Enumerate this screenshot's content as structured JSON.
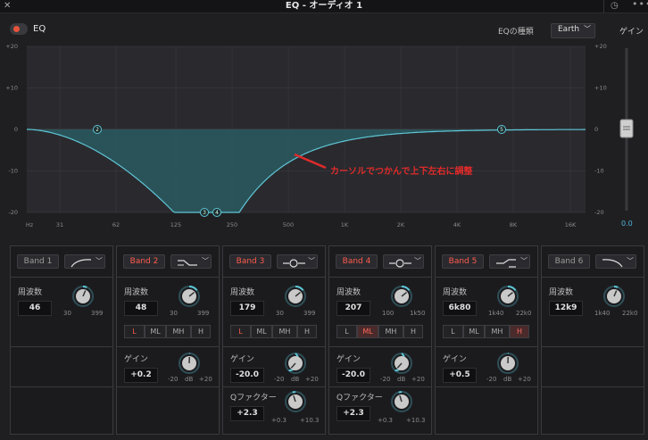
{
  "window": {
    "title": "EQ - オーディオ 1",
    "close": "✕",
    "history_icon": "◷",
    "more": "•••"
  },
  "header": {
    "eq_label": "EQ",
    "eq_type_label": "EQの種類",
    "eq_type_value": "Earth",
    "gain_label": "ゲイン"
  },
  "graph": {
    "y_ticks_left": [
      "+20",
      "+10",
      "0",
      "-10",
      "-20"
    ],
    "y_ticks_right": [
      "+20",
      "+10",
      "0",
      "-10",
      "-20"
    ],
    "x_ticks": [
      "Hz",
      "31",
      "62",
      "125",
      "250",
      "500",
      "1K",
      "2K",
      "4K",
      "8K",
      "16K"
    ],
    "annotation": "カーソルでつかんで上下左右に調整",
    "nodes": [
      "2",
      "3",
      "4",
      "5"
    ],
    "output_gain": "0.0",
    "colors": {
      "curve": "#5ec6d6",
      "fill": "#2a5a60",
      "annotation": "#e02a2a"
    }
  },
  "bands": [
    {
      "label": "Band 1",
      "active": false,
      "shape": "lowcut",
      "freq_label": "周波数",
      "freq": "46",
      "range": [
        "30",
        "399"
      ]
    },
    {
      "label": "Band 2",
      "active": true,
      "shape": "lowshelf",
      "freq_label": "周波数",
      "freq": "48",
      "range": [
        "30",
        "399"
      ],
      "segments": [
        "L",
        "ML",
        "MH",
        "H"
      ],
      "selected": "L",
      "gain_label": "ゲイン",
      "gain": "+0.2",
      "gain_range": [
        "-20",
        "dB",
        "+20"
      ]
    },
    {
      "label": "Band 3",
      "active": true,
      "shape": "bell",
      "freq_label": "周波数",
      "freq": "179",
      "range": [
        "30",
        "399"
      ],
      "segments": [
        "L",
        "ML",
        "MH",
        "H"
      ],
      "selected": "L",
      "gain_label": "ゲイン",
      "gain": "-20.0",
      "gain_range": [
        "-20",
        "dB",
        "+20"
      ],
      "q_label": "Qファクター",
      "q": "+2.3",
      "q_range": [
        "+0.3",
        "+10.3"
      ]
    },
    {
      "label": "Band 4",
      "active": true,
      "shape": "bell",
      "freq_label": "周波数",
      "freq": "207",
      "range": [
        "100",
        "1k50"
      ],
      "segments": [
        "L",
        "ML",
        "MH",
        "H"
      ],
      "selected": "ML",
      "gain_label": "ゲイン",
      "gain": "-20.0",
      "gain_range": [
        "-20",
        "dB",
        "+20"
      ],
      "q_label": "Qファクター",
      "q": "+2.3",
      "q_range": [
        "+0.3",
        "+10.3"
      ]
    },
    {
      "label": "Band 5",
      "active": true,
      "shape": "highshelf",
      "freq_label": "周波数",
      "freq": "6k80",
      "range": [
        "1k40",
        "22k0"
      ],
      "segments": [
        "L",
        "ML",
        "MH",
        "H"
      ],
      "selected": "H",
      "gain_label": "ゲイン",
      "gain": "+0.5",
      "gain_range": [
        "-20",
        "dB",
        "+20"
      ]
    },
    {
      "label": "Band 6",
      "active": false,
      "shape": "highcut",
      "freq_label": "周波数",
      "freq": "12k9",
      "range": [
        "1k40",
        "22k0"
      ]
    }
  ]
}
